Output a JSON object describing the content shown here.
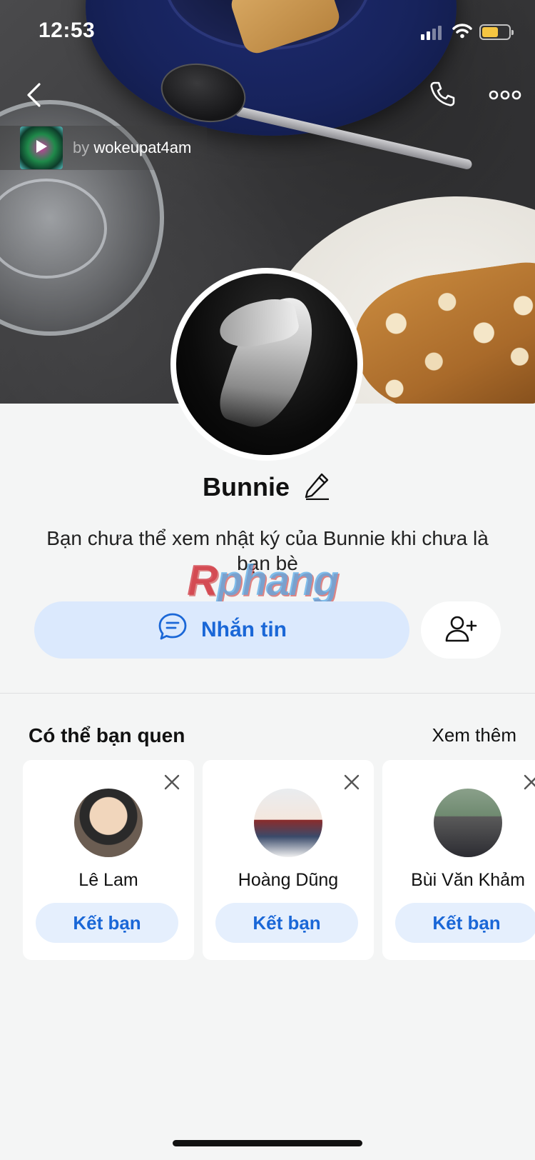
{
  "status_bar": {
    "time": "12:53"
  },
  "header": {
    "music": {
      "by_prefix": "by ",
      "artist": "wokeupat4am"
    }
  },
  "profile": {
    "name": "Bunnie",
    "notice": "Bạn chưa thể xem nhật ký của Bunnie khi chưa là bạn bè",
    "watermark": "Rphang"
  },
  "actions": {
    "message_label": "Nhắn tin"
  },
  "suggestions": {
    "title": "Có thể bạn quen",
    "see_more": "Xem thêm",
    "items": [
      {
        "name": "Lê Lam",
        "button": "Kết bạn"
      },
      {
        "name": "Hoàng Dũng",
        "button": "Kết bạn"
      },
      {
        "name": "Bùi Văn Khảm",
        "button": "Kết bạn"
      }
    ]
  },
  "colors": {
    "accent": "#1a67d7",
    "button_bg": "#dbe9fd",
    "page_bg": "#f4f5f5"
  },
  "icons": {
    "back": "chevron-left-icon",
    "call": "phone-icon",
    "more": "more-dots-icon",
    "edit": "pencil-icon",
    "message": "chat-bubble-icon",
    "add_friend": "add-user-icon",
    "dismiss": "close-icon"
  }
}
